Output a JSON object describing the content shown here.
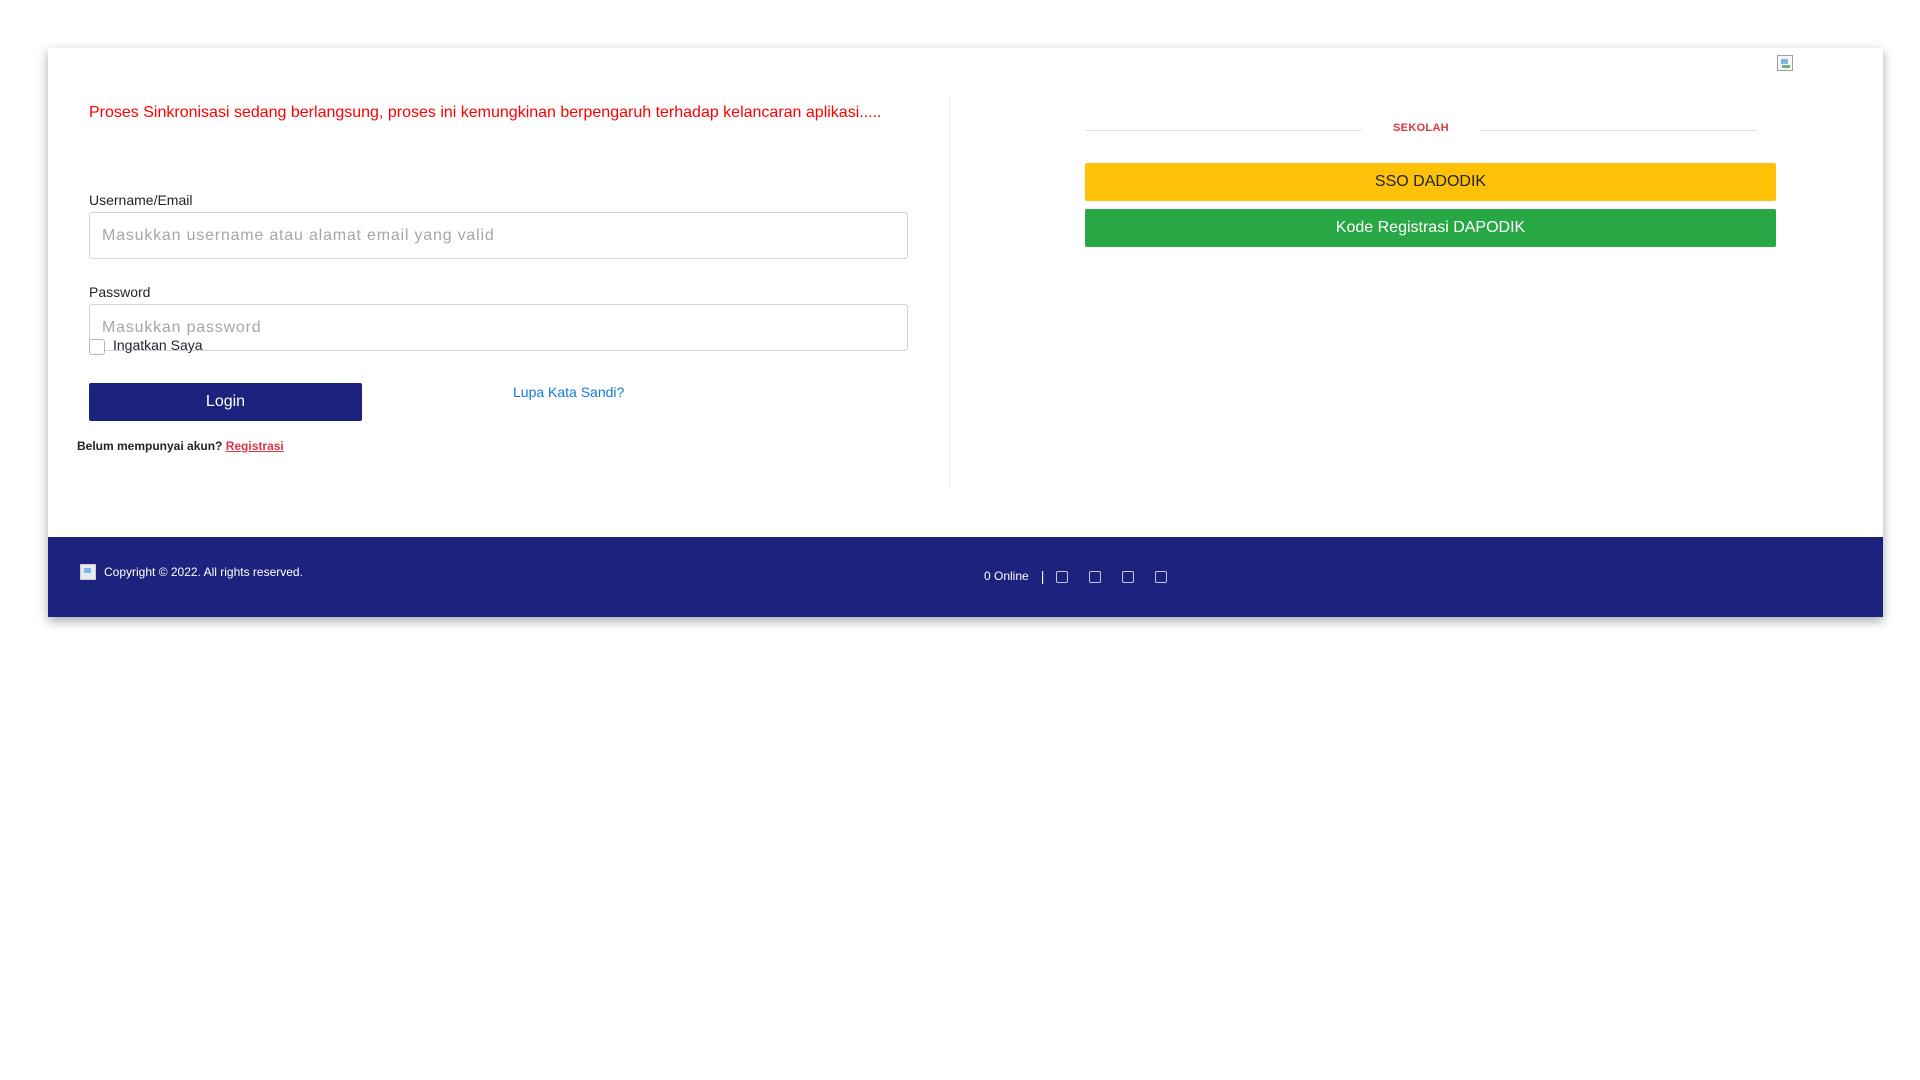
{
  "header": {
    "image_icon": "broken-image-icon"
  },
  "login": {
    "sync_message": "Proses Sinkronisasi sedang berlangsung, proses ini kemungkinan berpengaruh terhadap kelancaran aplikasi.....",
    "username_label": "Username/Email",
    "username_value": "",
    "username_placeholder": "Masukkan username atau alamat email yang valid",
    "password_label": "Password",
    "password_value": "",
    "password_placeholder": "Masukkan password",
    "remember_label": "Ingatkan Saya",
    "remember_checked": false,
    "login_button": "Login",
    "forgot_password": "Lupa Kata Sandi?",
    "no_account_text": "Belum mempunyai akun?",
    "register_link": "Registrasi"
  },
  "school": {
    "heading": "SEKOLAH",
    "sso_button": "SSO DADODIK",
    "kode_button": "Kode Registrasi DAPODIK"
  },
  "footer": {
    "logo_icon": "broken-image-icon",
    "copyright": "Copyright © 2022. All rights reserved.",
    "online_count": "0 Online",
    "separator": "|",
    "social_icons": [
      "social-icon-1",
      "social-icon-2",
      "social-icon-3",
      "social-icon-4"
    ]
  },
  "colors": {
    "primary_navy": "#1b237e",
    "warning_yellow": "#ffc107",
    "success_green": "#28a745",
    "alert_red": "#ff0000",
    "heading_red": "#dc3545",
    "link_blue": "#0d7bd8"
  }
}
